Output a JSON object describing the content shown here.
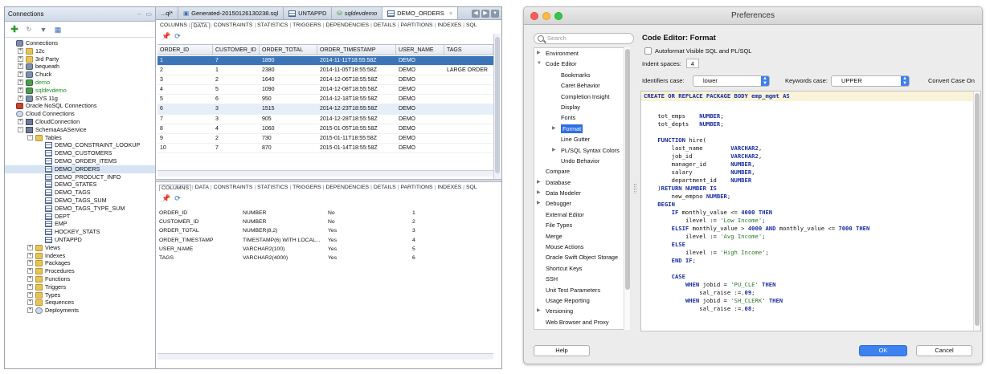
{
  "connections": {
    "title": "Connections",
    "tree": [
      {
        "label": "Connections",
        "depth": 0,
        "icon": "db",
        "toggle": ""
      },
      {
        "label": "12c",
        "depth": 1,
        "icon": "folder",
        "toggle": "+"
      },
      {
        "label": "3rd Party",
        "depth": 1,
        "icon": "folder",
        "toggle": "+"
      },
      {
        "label": "bequeath",
        "depth": 1,
        "icon": "db",
        "toggle": "+"
      },
      {
        "label": "Chuck",
        "depth": 1,
        "icon": "db",
        "toggle": "+"
      },
      {
        "label": "demo",
        "depth": 1,
        "icon": "dbg",
        "toggle": "+",
        "green": true
      },
      {
        "label": "sqldevdemo",
        "depth": 1,
        "icon": "dbg",
        "toggle": "+",
        "green": true
      },
      {
        "label": "SYS 11g",
        "depth": 1,
        "icon": "db",
        "toggle": "+"
      },
      {
        "label": "Oracle NoSQL Connections",
        "depth": 0,
        "icon": "nosql",
        "toggle": ""
      },
      {
        "label": "Cloud Connections",
        "depth": 0,
        "icon": "cloud",
        "toggle": ""
      },
      {
        "label": "CloudConnection",
        "depth": 1,
        "icon": "conn",
        "toggle": "+"
      },
      {
        "label": "SchemaAsAService",
        "depth": 1,
        "icon": "conn",
        "toggle": "-"
      },
      {
        "label": "Tables",
        "depth": 2,
        "icon": "folder",
        "toggle": "-"
      },
      {
        "label": "DEMO_CONSTRAINT_LOOKUP",
        "depth": 3,
        "icon": "table",
        "toggle": ""
      },
      {
        "label": "DEMO_CUSTOMERS",
        "depth": 3,
        "icon": "table",
        "toggle": ""
      },
      {
        "label": "DEMO_ORDER_ITEMS",
        "depth": 3,
        "icon": "table",
        "toggle": ""
      },
      {
        "label": "DEMO_ORDERS",
        "depth": 3,
        "icon": "table",
        "toggle": "",
        "selected": true
      },
      {
        "label": "DEMO_PRODUCT_INFO",
        "depth": 3,
        "icon": "table",
        "toggle": ""
      },
      {
        "label": "DEMO_STATES",
        "depth": 3,
        "icon": "table",
        "toggle": ""
      },
      {
        "label": "DEMO_TAGS",
        "depth": 3,
        "icon": "table",
        "toggle": ""
      },
      {
        "label": "DEMO_TAGS_SUM",
        "depth": 3,
        "icon": "table",
        "toggle": ""
      },
      {
        "label": "DEMO_TAGS_TYPE_SUM",
        "depth": 3,
        "icon": "table",
        "toggle": ""
      },
      {
        "label": "DEPT",
        "depth": 3,
        "icon": "table",
        "toggle": ""
      },
      {
        "label": "EMP",
        "depth": 3,
        "icon": "table",
        "toggle": ""
      },
      {
        "label": "HOCKEY_STATS",
        "depth": 3,
        "icon": "table",
        "toggle": ""
      },
      {
        "label": "UNTAPPD",
        "depth": 3,
        "icon": "table",
        "toggle": ""
      },
      {
        "label": "Views",
        "depth": 2,
        "icon": "folder",
        "toggle": "+"
      },
      {
        "label": "Indexes",
        "depth": 2,
        "icon": "folder",
        "toggle": "+"
      },
      {
        "label": "Packages",
        "depth": 2,
        "icon": "folder",
        "toggle": "+"
      },
      {
        "label": "Procedures",
        "depth": 2,
        "icon": "folder",
        "toggle": "+"
      },
      {
        "label": "Functions",
        "depth": 2,
        "icon": "folder",
        "toggle": "+"
      },
      {
        "label": "Triggers",
        "depth": 2,
        "icon": "folder",
        "toggle": "+"
      },
      {
        "label": "Types",
        "depth": 2,
        "icon": "folder",
        "toggle": "+"
      },
      {
        "label": "Sequences",
        "depth": 2,
        "icon": "folder",
        "toggle": "+"
      },
      {
        "label": "Deployments",
        "depth": 2,
        "icon": "cloud",
        "toggle": "+"
      }
    ]
  },
  "doc_tabs": [
    {
      "label": "...ql*",
      "icon": "none",
      "italic": false
    },
    {
      "label": "Generated-20150126130238.sql",
      "icon": "sql",
      "italic": false
    },
    {
      "label": "UNTAPPD",
      "icon": "table",
      "italic": false
    },
    {
      "label": "sqldevdemo",
      "icon": "conn",
      "italic": true
    },
    {
      "label": "DEMO_ORDERS",
      "icon": "table",
      "italic": false,
      "active": true
    }
  ],
  "sub_tabs": [
    "COLUMNS",
    "DATA",
    "CONSTRAINTS",
    "STATISTICS",
    "TRIGGERS",
    "DEPENDENCIES",
    "DETAILS",
    "PARTITIONS",
    "INDEXES",
    "SQL"
  ],
  "sub_tabs2": [
    "COLUMNS",
    "DATA",
    "CONSTRAINTS",
    "STATISTICS",
    "TRIGGERS",
    "DEPENDENCIES",
    "DETAILS",
    "PARTITIONS",
    "INDEXES",
    "SQL"
  ],
  "data_grid": {
    "headers": [
      "ORDER_ID",
      "CUSTOMER_ID",
      "ORDER_TOTAL",
      "ORDER_TIMESTAMP",
      "USER_NAME",
      "TAGS"
    ],
    "rows": [
      [
        "1",
        "7",
        "1890",
        "2014-11-11T18:55:58Z",
        "DEMO",
        ""
      ],
      [
        "2",
        "1",
        "2380",
        "2014-11-05T18:55:58Z",
        "DEMO",
        "LARGE ORDER"
      ],
      [
        "3",
        "2",
        "1640",
        "2014-12-06T18:55:58Z",
        "DEMO",
        ""
      ],
      [
        "4",
        "5",
        "1090",
        "2014-12-08T18:55:58Z",
        "DEMO",
        ""
      ],
      [
        "5",
        "6",
        "950",
        "2014-12-18T18:55:58Z",
        "DEMO",
        ""
      ],
      [
        "6",
        "3",
        "1515",
        "2014-12-23T18:55:58Z",
        "DEMO",
        ""
      ],
      [
        "7",
        "3",
        "905",
        "2014-12-28T18:55:58Z",
        "DEMO",
        ""
      ],
      [
        "8",
        "4",
        "1060",
        "2015-01-05T18:55:58Z",
        "DEMO",
        ""
      ],
      [
        "9",
        "2",
        "730",
        "2015-01-11T18:55:58Z",
        "DEMO",
        ""
      ],
      [
        "10",
        "7",
        "870",
        "2015-01-14T18:55:58Z",
        "DEMO",
        ""
      ]
    ]
  },
  "columns_grid": {
    "rows": [
      [
        "ORDER_ID",
        "NUMBER",
        "No",
        "1"
      ],
      [
        "CUSTOMER_ID",
        "NUMBER",
        "No",
        "2"
      ],
      [
        "ORDER_TOTAL",
        "NUMBER(8,2)",
        "Yes",
        "3"
      ],
      [
        "ORDER_TIMESTAMP",
        "TIMESTAMP(6) WITH LOCAL...",
        "Yes",
        "4"
      ],
      [
        "USER_NAME",
        "VARCHAR2(100)",
        "Yes",
        "5"
      ],
      [
        "TAGS",
        "VARCHAR2(4000)",
        "Yes",
        "6"
      ]
    ]
  },
  "prefs": {
    "title": "Preferences",
    "search_placeholder": "Search",
    "nav": [
      {
        "label": "Environment",
        "arrow": "▶",
        "depth": 0
      },
      {
        "label": "Code Editor",
        "arrow": "▼",
        "depth": 0
      },
      {
        "label": "Bookmarks",
        "arrow": "",
        "depth": 1
      },
      {
        "label": "Caret Behavior",
        "arrow": "",
        "depth": 1
      },
      {
        "label": "Completion Insight",
        "arrow": "",
        "depth": 1
      },
      {
        "label": "Display",
        "arrow": "",
        "depth": 1
      },
      {
        "label": "Fonts",
        "arrow": "",
        "depth": 1
      },
      {
        "label": "Format",
        "arrow": "▶",
        "depth": 1,
        "selected": true
      },
      {
        "label": "Line Gutter",
        "arrow": "",
        "depth": 1
      },
      {
        "label": "PL/SQL Syntax Colors",
        "arrow": "▶",
        "depth": 1
      },
      {
        "label": "Undo Behavior",
        "arrow": "",
        "depth": 1
      },
      {
        "label": "Compare",
        "arrow": "",
        "depth": 0
      },
      {
        "label": "Database",
        "arrow": "▶",
        "depth": 0
      },
      {
        "label": "Data Modeler",
        "arrow": "▶",
        "depth": 0
      },
      {
        "label": "Debugger",
        "arrow": "▶",
        "depth": 0
      },
      {
        "label": "External Editor",
        "arrow": "",
        "depth": 0
      },
      {
        "label": "File Types",
        "arrow": "",
        "depth": 0
      },
      {
        "label": "Merge",
        "arrow": "",
        "depth": 0
      },
      {
        "label": "Mouse Actions",
        "arrow": "",
        "depth": 0
      },
      {
        "label": "Oracle Swift Object Storage",
        "arrow": "",
        "depth": 0
      },
      {
        "label": "Shortcut Keys",
        "arrow": "",
        "depth": 0
      },
      {
        "label": "SSH",
        "arrow": "",
        "depth": 0
      },
      {
        "label": "Unit Test Parameters",
        "arrow": "",
        "depth": 0
      },
      {
        "label": "Usage Reporting",
        "arrow": "",
        "depth": 0
      },
      {
        "label": "Versioning",
        "arrow": "▶",
        "depth": 0
      },
      {
        "label": "Web Browser and Proxy",
        "arrow": "",
        "depth": 0
      }
    ],
    "page_title": "Code Editor: Format",
    "autoformat_label": "Autoformat Visible SQL and PL/SQL",
    "indent_label": "Indent spaces:",
    "indent_value": "4",
    "identifiers_label": "Identifiers case:",
    "identifiers_value": "lower",
    "keywords_label": "Keywords case:",
    "keywords_value": "UPPER",
    "convert_label": "Convert Case On",
    "code_first": "CREATE OR REPLACE PACKAGE BODY emp_mgmt AS",
    "code_lines": [
      "",
      "    tot_emps    NUMBER;",
      "    tot_depts   NUMBER;",
      "",
      "    FUNCTION hire(",
      "        last_name        VARCHAR2,",
      "        job_id           VARCHAR2,",
      "        manager_id       NUMBER,",
      "        salary           NUMBER,",
      "        department_id    NUMBER",
      "    )RETURN NUMBER IS",
      "        new_empno NUMBER;",
      "    BEGIN",
      "        IF monthly_value <= 4000 THEN",
      "            ilevel := 'Low Income';",
      "        ELSIF monthly_value > 4000 AND monthly_value <= 7000 THEN",
      "            ilevel := 'Avg Income';",
      "        ELSE",
      "            ilevel := 'High Income';",
      "        END IF;",
      "",
      "        CASE",
      "            WHEN jobid = 'PU_CLE' THEN",
      "                sal_raise :=.09;",
      "            WHEN jobid = 'SH_CLERK' THEN",
      "                sal_raise :=.08;"
    ],
    "help_label": "Help",
    "ok_label": "OK",
    "cancel_label": "Cancel"
  }
}
